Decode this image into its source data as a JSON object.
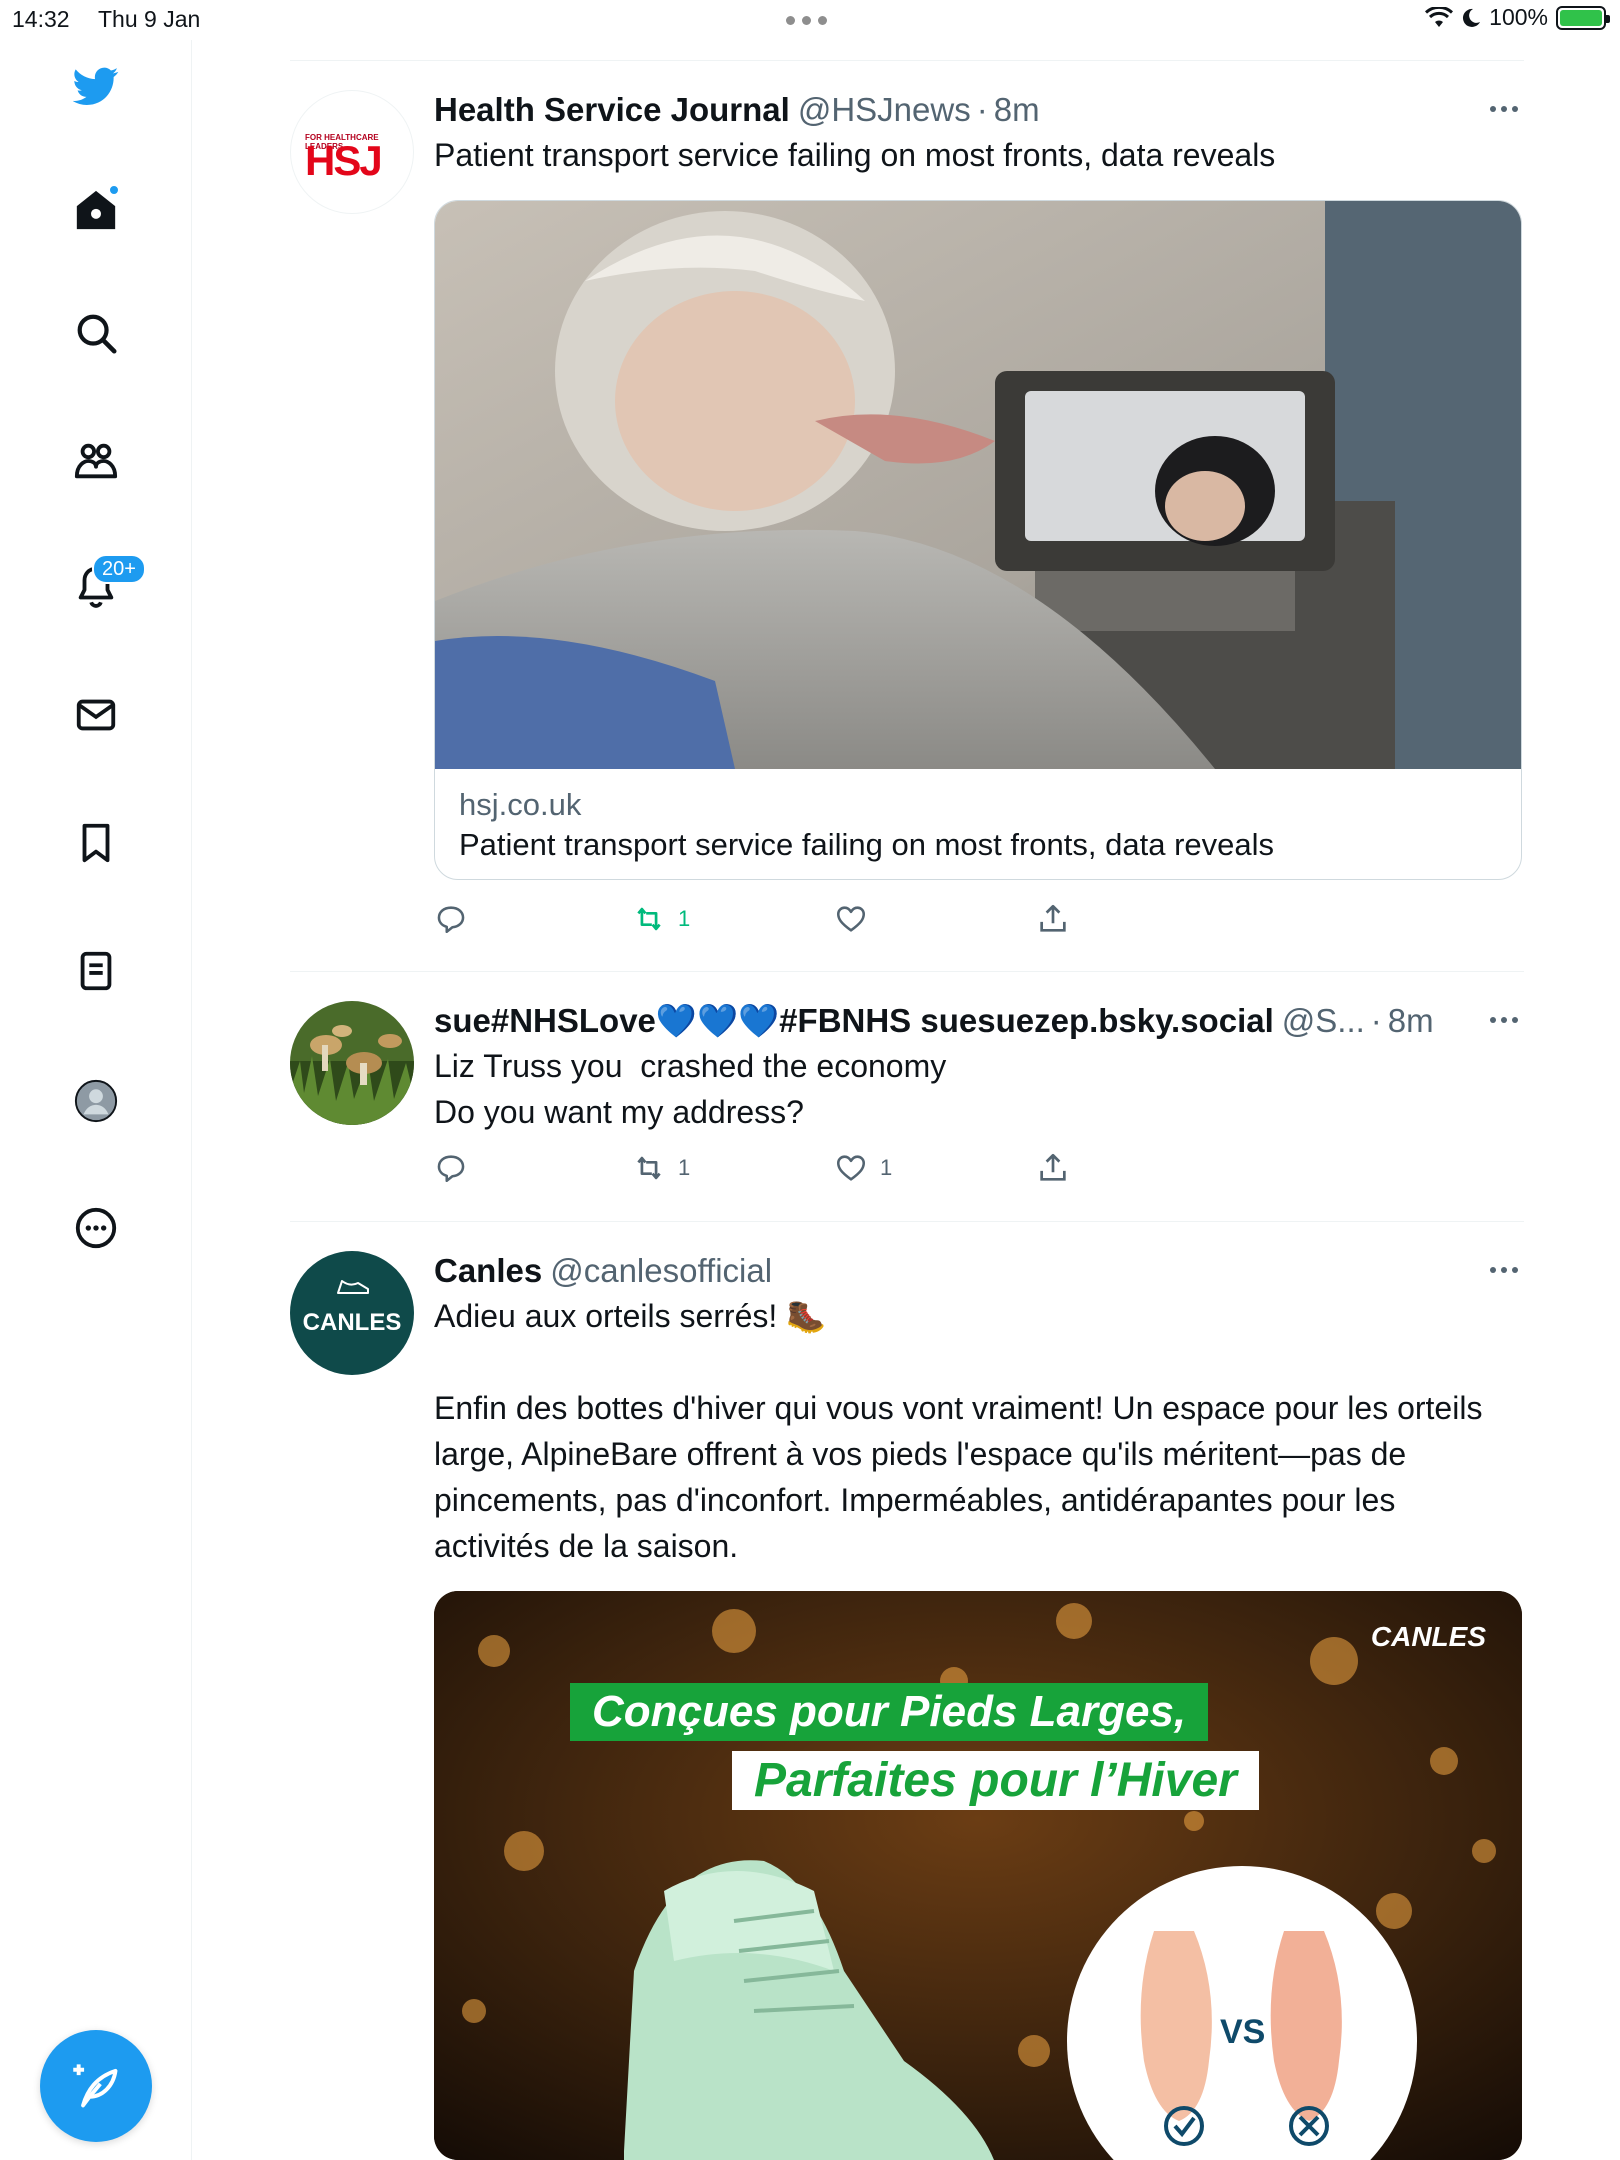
{
  "status_bar": {
    "time": "14:32",
    "date": "Thu 9 Jan",
    "battery": "100%"
  },
  "sidebar": {
    "notifications_badge": "20+",
    "accent": "#1d9bf0"
  },
  "tweets": [
    {
      "name": "Health Service Journal",
      "handle": "@HSJnews",
      "sep": "·",
      "ago": "8m",
      "text": "Patient transport service failing on most fronts, data reveals",
      "avatar_logo": "HSJ",
      "avatar_tagline": "FOR HEALTHCARE LEADERS",
      "card": {
        "domain": "hsj.co.uk",
        "title": "Patient transport service failing on most fronts, data reveals"
      },
      "actions": {
        "reply": "",
        "retweet": "1",
        "like": "",
        "share": ""
      }
    },
    {
      "name": "sue#NHSLove💙💙💙#FBNHS suesuezep.bsky.social",
      "handle": "@S...",
      "sep": "·",
      "ago": "8m",
      "text_line1": "Liz Truss you  crashed the economy",
      "text_line2": "Do you want my address?",
      "actions": {
        "reply": "",
        "retweet": "1",
        "like": "1",
        "share": ""
      }
    },
    {
      "name": "Canles",
      "handle": "@canlesofficial",
      "text_line1": "Adieu aux orteils serrés! 🥾",
      "text_para": "Enfin des bottes d'hiver qui vous vont vraiment! Un espace pour les orteils large, AlpineBare offrent à vos pieds l'espace qu'ils méritent—pas de pincements, pas d'inconfort. Imperméables, antidérapantes pour les activités de la saison.",
      "avatar_logo": "CANLES",
      "media": {
        "brand": "CANLES",
        "headline1": "Conçues pour Pieds Larges,",
        "headline2": "Parfaites pour l’Hiver",
        "vs": "VS"
      }
    }
  ]
}
